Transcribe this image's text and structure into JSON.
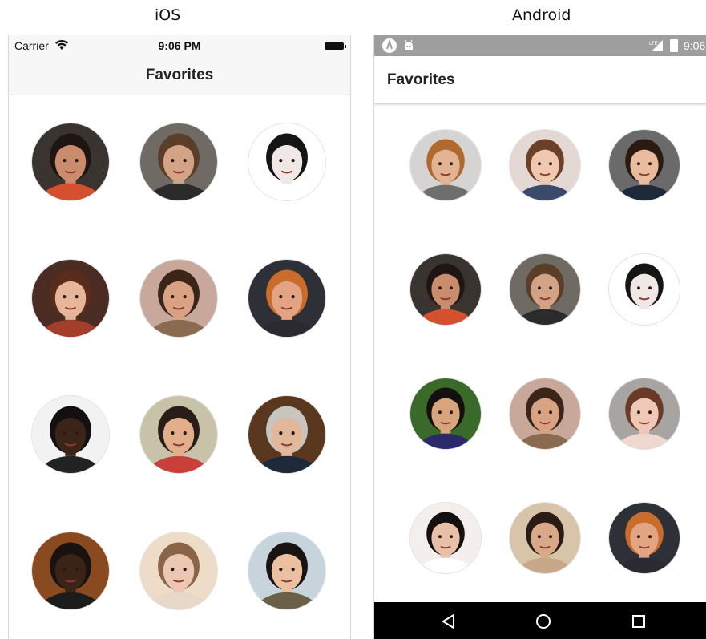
{
  "labels": {
    "ios": "iOS",
    "android": "Android"
  },
  "ios": {
    "carrier": "Carrier",
    "time": "9:06 PM",
    "title": "Favorites"
  },
  "android": {
    "time": "9:06",
    "title": "Favorites"
  },
  "colors": {
    "ios_bar": "#f7f7f7",
    "android_status": "#9e9e9e",
    "android_nav": "#000000"
  },
  "ios_favorites": [
    {
      "bg": "#3a3430",
      "skin": "#c98d6e",
      "hair": "#1e1613",
      "shirt": "#d4502e"
    },
    {
      "bg": "#6f6a64",
      "skin": "#d2a384",
      "hair": "#5b3e28",
      "shirt": "#2b2b2b"
    },
    {
      "bg": "#ffffff",
      "skin": "#f0e8e4",
      "hair": "#151515",
      "shirt": "#ffffff"
    },
    {
      "bg": "#4a2c22",
      "skin": "#e7b59a",
      "hair": "#5a2c1c",
      "shirt": "#a33e2a"
    },
    {
      "bg": "#c8a89a",
      "skin": "#d8a283",
      "hair": "#3a2518",
      "shirt": "#8a6a50"
    },
    {
      "bg": "#2e3038",
      "skin": "#e2a482",
      "hair": "#c96c2c",
      "shirt": "#2a2a30"
    },
    {
      "bg": "#f2f2f2",
      "skin": "#3b2418",
      "hair": "#141010",
      "shirt": "#222222"
    },
    {
      "bg": "#c8c2a8",
      "skin": "#e2ae8c",
      "hair": "#2a1c16",
      "shirt": "#c9403a"
    },
    {
      "bg": "#5a3820",
      "skin": "#e2b79a",
      "hair": "#c8c4be",
      "shirt": "#1e2a3a"
    },
    {
      "bg": "#8a4a20",
      "skin": "#3a2418",
      "hair": "#1a1210",
      "shirt": "#1c1c1c"
    },
    {
      "bg": "#ecdcc8",
      "skin": "#ecc8b4",
      "hair": "#8a6448",
      "shirt": "#e8d8c8"
    },
    {
      "bg": "#c8d4dc",
      "skin": "#eac0a0",
      "hair": "#181414",
      "shirt": "#6a6048"
    }
  ],
  "android_favorites": [
    {
      "bg": "#d6d4d2",
      "skin": "#e2b494",
      "hair": "#b06a30",
      "shirt": "#6e6e6e"
    },
    {
      "bg": "#e4d8d4",
      "skin": "#f0c8b0",
      "hair": "#6a4028",
      "shirt": "#3a4a6a"
    },
    {
      "bg": "#6a6a6a",
      "skin": "#e8bc9c",
      "hair": "#2a1a12",
      "shirt": "#1e2a3a"
    },
    {
      "bg": "#3a3430",
      "skin": "#c98d6e",
      "hair": "#1e1613",
      "shirt": "#d4502e"
    },
    {
      "bg": "#6f6a64",
      "skin": "#d2a384",
      "hair": "#5b3e28",
      "shirt": "#2b2b2b"
    },
    {
      "bg": "#ffffff",
      "skin": "#f0e8e4",
      "hair": "#151515",
      "shirt": "#ffffff"
    },
    {
      "bg": "#3a6a2a",
      "skin": "#d8a47e",
      "hair": "#141010",
      "shirt": "#2a2a6a"
    },
    {
      "bg": "#c8a89a",
      "skin": "#d8a283",
      "hair": "#3a2518",
      "shirt": "#8a6a50"
    },
    {
      "bg": "#a8a4a2",
      "skin": "#f0c8b8",
      "hair": "#6a3a28",
      "shirt": "#f0d8d0"
    },
    {
      "bg": "#f4eeec",
      "skin": "#e8c0a8",
      "hair": "#141010",
      "shirt": "#ffffff"
    },
    {
      "bg": "#d8c4a8",
      "skin": "#d8a888",
      "hair": "#2a1c14",
      "shirt": "#c8a888"
    },
    {
      "bg": "#2e3038",
      "skin": "#e2a482",
      "hair": "#c96c2c",
      "shirt": "#2a2a30"
    }
  ]
}
